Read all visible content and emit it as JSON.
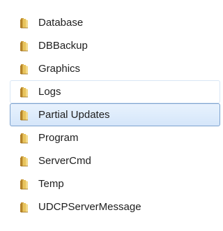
{
  "folders": [
    {
      "name": "Database",
      "state": "normal",
      "icon": "folder-icon"
    },
    {
      "name": "DBBackup",
      "state": "normal",
      "icon": "folder-icon"
    },
    {
      "name": "Graphics",
      "state": "normal",
      "icon": "folder-icon"
    },
    {
      "name": "Logs",
      "state": "hover",
      "icon": "folder-icon"
    },
    {
      "name": "Partial Updates",
      "state": "selected",
      "icon": "folder-icon"
    },
    {
      "name": "Program",
      "state": "normal",
      "icon": "folder-icon"
    },
    {
      "name": "ServerCmd",
      "state": "normal",
      "icon": "folder-icon"
    },
    {
      "name": "Temp",
      "state": "normal",
      "icon": "folder-icon"
    },
    {
      "name": "UDCPServerMessage",
      "state": "normal",
      "icon": "folder-icon"
    }
  ],
  "colors": {
    "folder_body": "#e8c35c",
    "folder_dark": "#b8862a",
    "selection_border": "#7da2ce",
    "selection_fill": "#dceafb",
    "hover_border": "#d8e6f5"
  }
}
